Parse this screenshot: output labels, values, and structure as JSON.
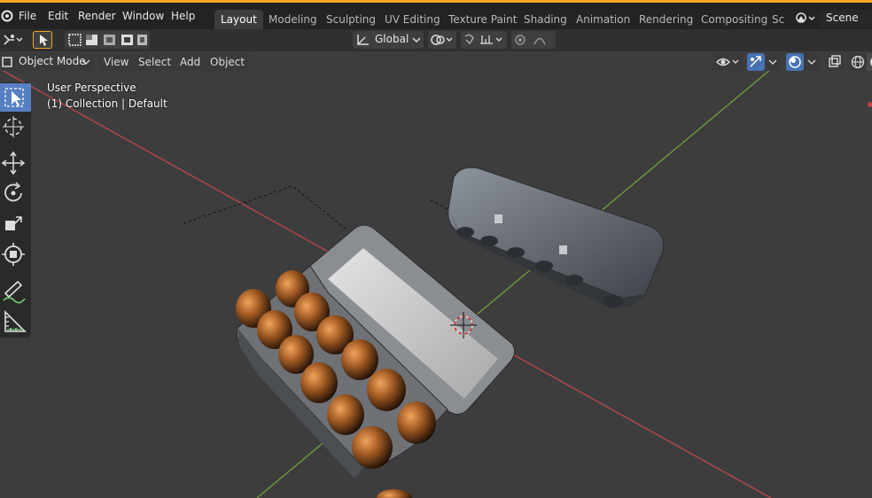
{
  "colors": {
    "accent": "#f5a623",
    "viewport_bg": "#3d3d3d",
    "topbar_bg": "#232323",
    "active_tool": "#5680c2",
    "x_axis": "#b5484c",
    "y_axis": "#6c9a3b"
  },
  "menu": {
    "logo_icon": "blender-logo-icon",
    "file": "File",
    "edit": "Edit",
    "render": "Render",
    "window": "Window",
    "help": "Help"
  },
  "workspaces": {
    "layout": "Layout",
    "modeling": "Modeling",
    "sculpting": "Sculpting",
    "uv_editing": "UV Editing",
    "texture_paint": "Texture Paint",
    "shading": "Shading",
    "animation": "Animation",
    "rendering": "Rendering",
    "compositing": "Compositing",
    "truncated": "Sc"
  },
  "scene": {
    "name": "Scene"
  },
  "tool_header": {
    "transform_orientation": "Global"
  },
  "viewport_header": {
    "mode": "Object Mode",
    "view": "View",
    "select": "Select",
    "add": "Add",
    "object": "Object"
  },
  "viewport": {
    "perspective": "User Perspective",
    "collection": "(1) Collection | Default"
  },
  "tools": [
    "select-box-icon",
    "cursor-icon",
    "move-icon",
    "rotate-icon",
    "scale-icon",
    "transform-icon",
    "annotate-icon",
    "measure-icon"
  ]
}
